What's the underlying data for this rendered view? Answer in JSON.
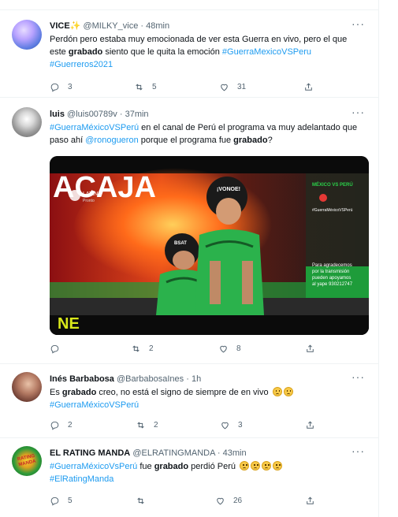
{
  "tweets": [
    {
      "name": "VICE",
      "handle": "@MILKY_vice",
      "time": "48min",
      "text_parts": {
        "p1": "Perdón pero estaba muy emocionada de ver esta Guerra en vivo, pero el que este ",
        "b1": "grabado",
        "p2": " siento que le quita la emoción ",
        "tag1": "#GuerraMexicoVSPeru",
        "tag2": "#Guerreros2021"
      },
      "counts": {
        "reply": "3",
        "retweet": "5",
        "like": "31"
      }
    },
    {
      "name": "luis",
      "handle": "@luis00789v",
      "time": "37min",
      "text_parts": {
        "tag1": "#GuerraMéxicoVSPerú",
        "p1": " en el canal de Perú  el programa va muy adelantado que paso ahí ",
        "mention": "@ronogueron",
        "p2": "  porque el programa fue ",
        "b1": "grabado",
        "p3": "?"
      },
      "video": {
        "banner": "ACAJA",
        "logo_text": "LATINA",
        "logo_sub": "Pronto",
        "helmet1": "¡VONOE!",
        "helmet2": "BSAT",
        "corner_logo": "NE",
        "overlay_lines": [
          "Para agradecemos",
          "por la transmisión",
          "pueden apoyamos",
          "al yape 930212747"
        ],
        "badge_top": "MÉXICO VS PERÚ",
        "badge_hashtag": "#GuerraMéxicoVSPerú"
      },
      "counts": {
        "reply": "",
        "retweet": "2",
        "like": "8"
      }
    },
    {
      "name": "Inés Barbabosa",
      "handle": "@BarbabosaInes",
      "time": "1h",
      "text_parts": {
        "p1": "Es ",
        "b1": "grabado",
        "p2": " creo, no está el signo de siempre de en vivo ",
        "tag1": "#GuerraMéxicoVSPerú"
      },
      "counts": {
        "reply": "2",
        "retweet": "2",
        "like": "3"
      }
    },
    {
      "name": "EL RATING MANDA",
      "handle": "@ELRATINGMANDA",
      "time": "43min",
      "avatar_text": "RATING MANDA",
      "text_parts": {
        "tag1": "#GuerraMéxicoVsPerú",
        "p1": " fue ",
        "b1": "grabado",
        "p2": " perdió Perú ",
        "tag2": "#ElRatingManda"
      },
      "counts": {
        "reply": "5",
        "retweet": "",
        "like": "26"
      }
    }
  ],
  "colors": {
    "link": "#1d9bf0",
    "muted": "#536471",
    "text": "#0f1419",
    "divider": "#eff3f4"
  },
  "icons": [
    "reply-icon",
    "retweet-icon",
    "like-icon",
    "share-icon",
    "more-icon",
    "sparkle-icon"
  ]
}
